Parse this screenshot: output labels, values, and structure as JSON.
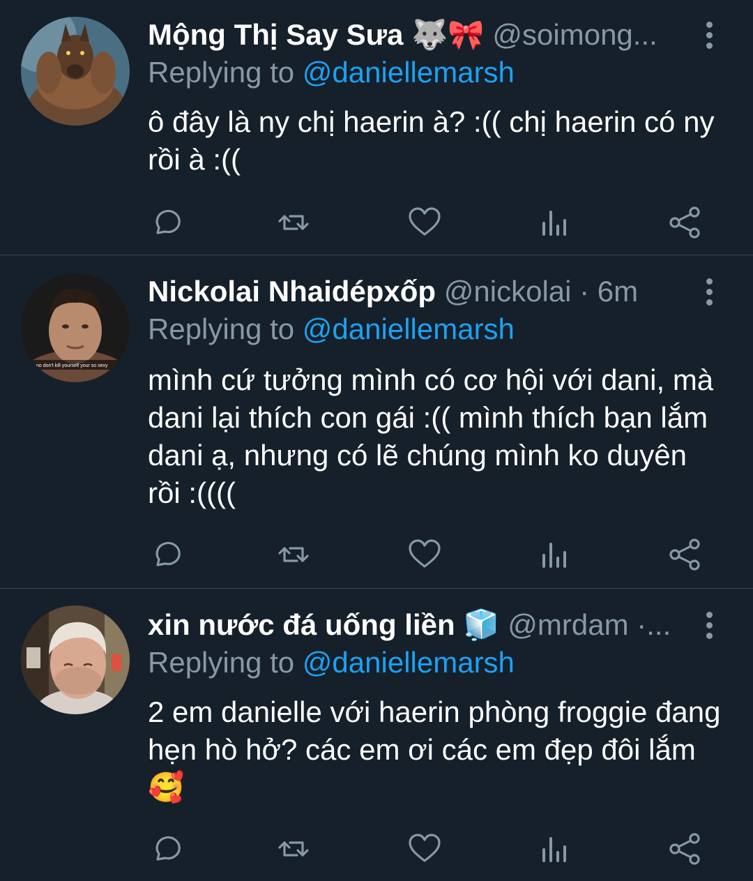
{
  "colors": {
    "background": "#15202b",
    "divider": "#38444d",
    "muted": "#8899a6",
    "link": "#1da1f2",
    "text": "#ffffff"
  },
  "tweets": [
    {
      "name": "Mộng Thị Say Sưa",
      "name_emoji": "🐺🎀",
      "handle": "@soimong...",
      "meta": "",
      "replying_label": "Replying to",
      "replying_handle": "@daniellemarsh",
      "text": "ô đây là ny chị haerin à? :(( chị haerin có ny rồi à :((",
      "avatar": "werewolf-avatar"
    },
    {
      "name": "Nickolai Nhaidépxốp",
      "name_emoji": "",
      "handle": "@nickolai",
      "meta": " · 6m",
      "replying_label": "Replying to",
      "replying_handle": "@daniellemarsh",
      "text": "mình cứ tưởng mình có cơ hội với dani, mà dani lại thích con gái :(( mình thích bạn lắm dani ạ, nhưng có lẽ chúng mình ko duyên rồi :((((",
      "avatar_caption": "no don't kill yourself your so sexy",
      "avatar": "man-selfie-avatar"
    },
    {
      "name": "xin nước đá uống liền",
      "name_emoji": "🧊",
      "handle": "@mrdam",
      "meta": " ·...",
      "replying_label": "Replying to",
      "replying_handle": "@daniellemarsh",
      "text": "2 em danielle với haerin phòng froggie đang hẹn hò hở? các em ơi các em đẹp đôi lắm",
      "text_emoji": "🥰",
      "avatar": "crying-man-avatar"
    }
  ],
  "action_icons": [
    "reply-icon",
    "retweet-icon",
    "like-icon",
    "analytics-icon",
    "share-icon"
  ]
}
